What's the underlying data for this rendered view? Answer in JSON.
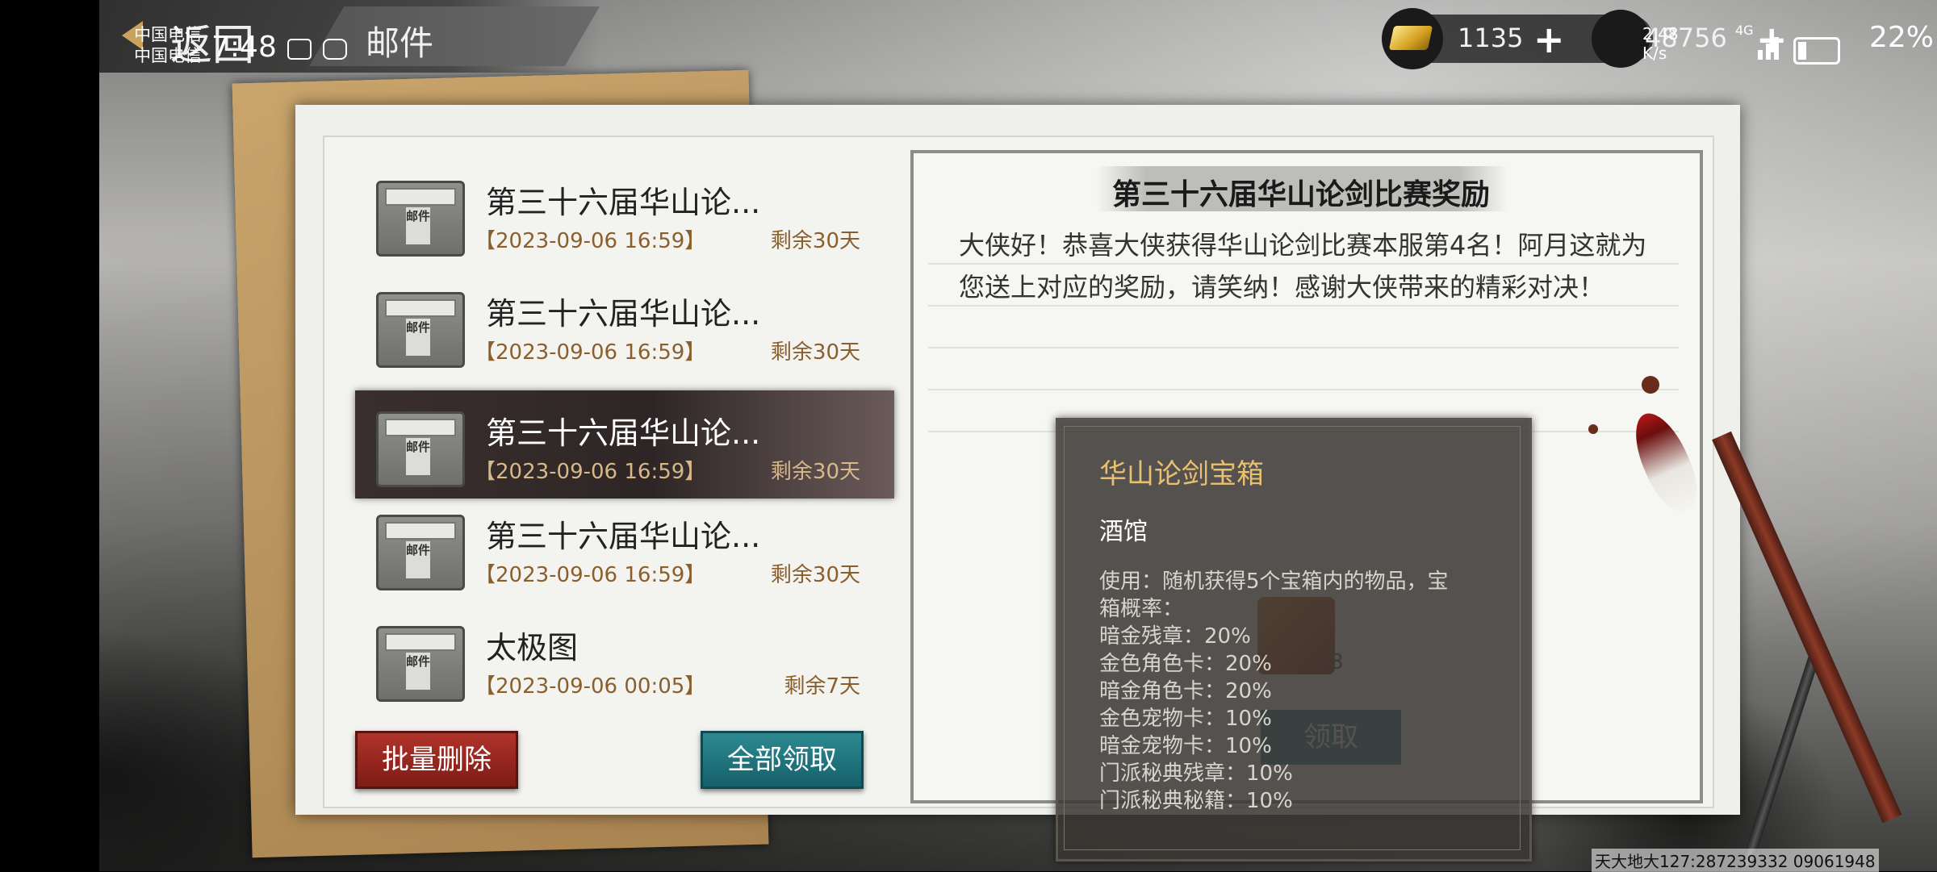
{
  "status_bar": {
    "carrier_top": "中国电信",
    "carrier_bottom": "中国电信",
    "time": "7:48",
    "net_speed_value": "2.48",
    "net_speed_unit": "K/s",
    "network": "4G",
    "battery_level": 0.22,
    "battery": "22%"
  },
  "header": {
    "back_label": "返回",
    "title": "邮件"
  },
  "currency": {
    "gold": "1135",
    "second": "48756"
  },
  "mail_list": [
    {
      "title": "第三十六届华山论...",
      "date": "【2023-09-06 16:59】",
      "remaining": "剩余30天"
    },
    {
      "title": "第三十六届华山论...",
      "date": "【2023-09-06 16:59】",
      "remaining": "剩余30天"
    },
    {
      "title": "第三十六届华山论...",
      "date": "【2023-09-06 16:59】",
      "remaining": "剩余30天"
    },
    {
      "title": "第三十六届华山论...",
      "date": "【2023-09-06 16:59】",
      "remaining": "剩余30天"
    },
    {
      "title": "太极图",
      "date": "【2023-09-06 00:05】",
      "remaining": "剩余7天"
    }
  ],
  "mail_icon_label": "邮件",
  "buttons": {
    "batch_delete": "批量删除",
    "claim_all": "全部领取"
  },
  "detail": {
    "title": "第三十六届华山论剑比赛奖励",
    "body": "大侠好！恭喜大侠获得华山论剑比赛本服第4名！阿月这就为您送上对应的奖励，请笑纳！感谢大侠带来的精彩对决！",
    "item_count": "8",
    "claim_label": "领取"
  },
  "tooltip": {
    "name": "华山论剑宝箱",
    "source": "酒馆",
    "desc_lines": [
      "使用：随机获得5个宝箱内的物品，宝",
      "箱概率：",
      "暗金残章：20%",
      "金色角色卡：20%",
      "暗金角色卡：20%",
      "金色宠物卡：10%",
      "暗金宠物卡：10%",
      "门派秘典残章：10%",
      "门派秘典秘籍：10%"
    ]
  },
  "watermark": "天大地大127:287239332 09061948"
}
